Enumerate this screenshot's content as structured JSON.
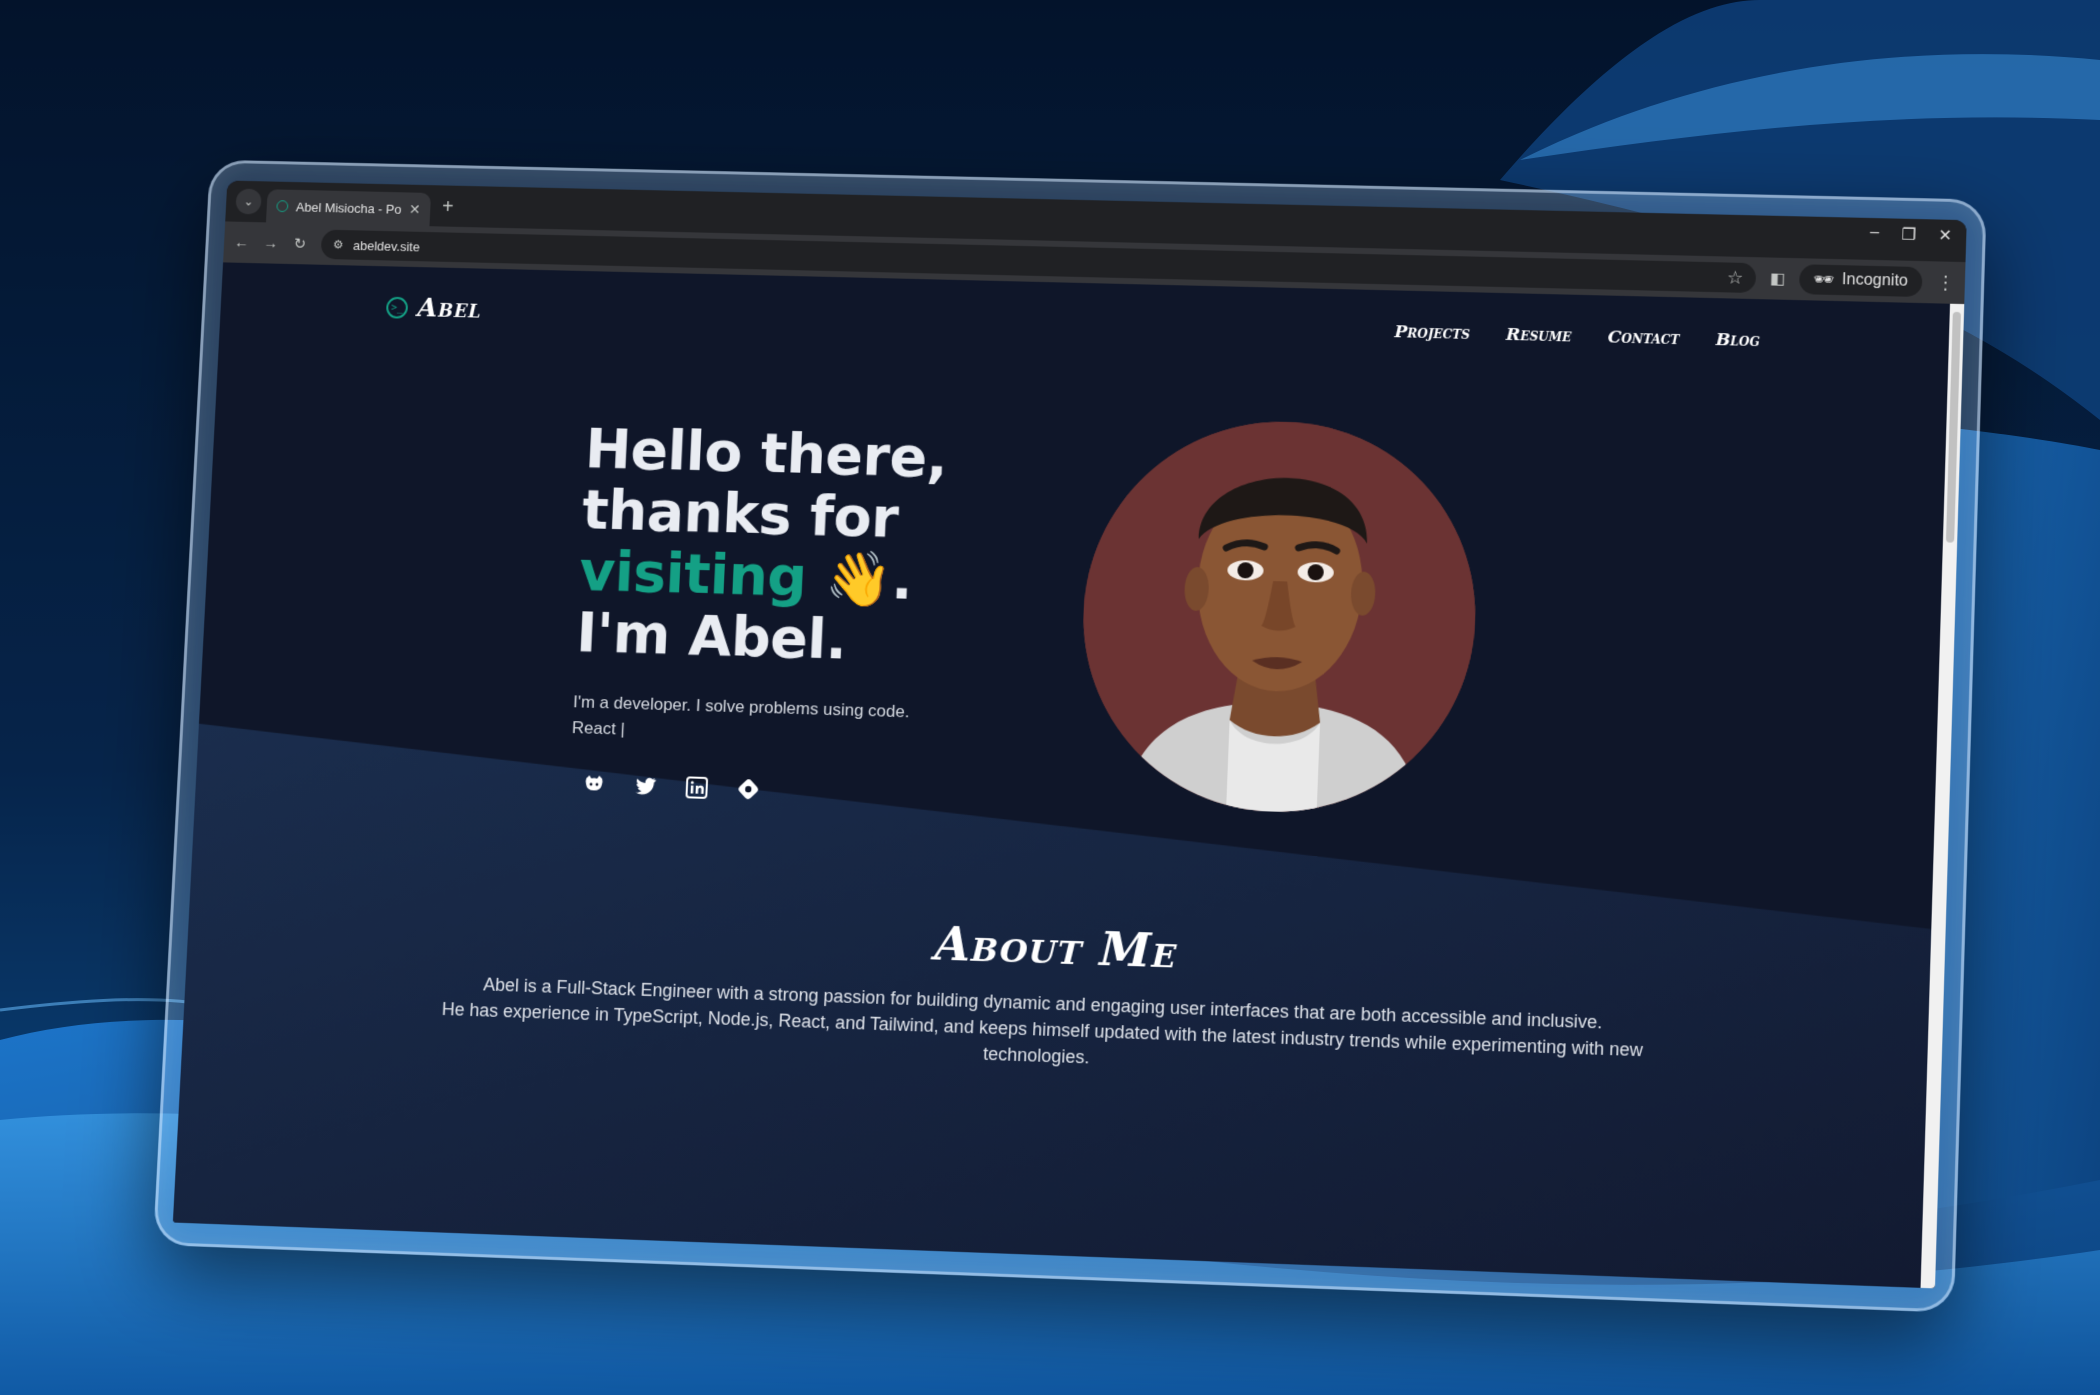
{
  "browser": {
    "tab_title": "Abel Misiocha - Portfolio",
    "url": "abeldev.site",
    "incognito_label": "Incognito"
  },
  "site": {
    "logo": "Abel",
    "nav": [
      "Projects",
      "Resume",
      "Contact",
      "Blog"
    ]
  },
  "hero": {
    "line1": "Hello there,",
    "line2": "thanks for",
    "line3_accent": "visiting",
    "line3_emoji": "👋",
    "line3_end": ".",
    "line4": "I'm Abel.",
    "subtitle": "I'm a developer. I solve problems using code.",
    "typing": "React |",
    "socials": [
      "github-icon",
      "twitter-icon",
      "linkedin-icon",
      "hashnode-icon"
    ]
  },
  "about": {
    "title": "About Me",
    "paragraph1": "Abel is a Full-Stack Engineer with a strong passion for building dynamic and engaging user interfaces that are both accessible and inclusive.",
    "paragraph2": "He has experience in TypeScript, Node.js, React, and Tailwind, and keeps himself updated with the latest industry trends while experimenting with new technologies."
  },
  "colors": {
    "accent": "#14a085",
    "page_bg": "#0f1629",
    "avatar_bg": "#6b3333"
  }
}
